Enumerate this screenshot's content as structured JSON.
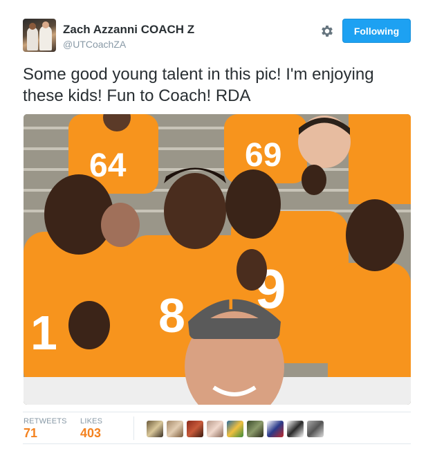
{
  "author": {
    "name": "Zach Azzanni COACH Z",
    "handle": "@UTCoachZA",
    "avatar_icon": "profile-photo"
  },
  "actions": {
    "settings_icon": "gear-icon",
    "follow_label": "Following"
  },
  "tweet": {
    "text": "Some good young talent in this pic! I'm enjoying these kids! Fun to Coach! RDA"
  },
  "stats": {
    "retweets_label": "RETWEETS",
    "retweets_value": "71",
    "likes_label": "LIKES",
    "likes_value": "403"
  },
  "likers": [
    {
      "icon": "user-avatar-1"
    },
    {
      "icon": "user-avatar-2"
    },
    {
      "icon": "user-avatar-3"
    },
    {
      "icon": "user-avatar-4"
    },
    {
      "icon": "user-avatar-5"
    },
    {
      "icon": "user-avatar-6"
    },
    {
      "icon": "user-avatar-7"
    },
    {
      "icon": "user-avatar-8"
    },
    {
      "icon": "user-avatar-9"
    }
  ],
  "colors": {
    "accent": "#1da1f2",
    "stat_value": "#f4821f",
    "text": "#292f33",
    "muted": "#8899a6",
    "jersey_orange": "#f7941d"
  }
}
